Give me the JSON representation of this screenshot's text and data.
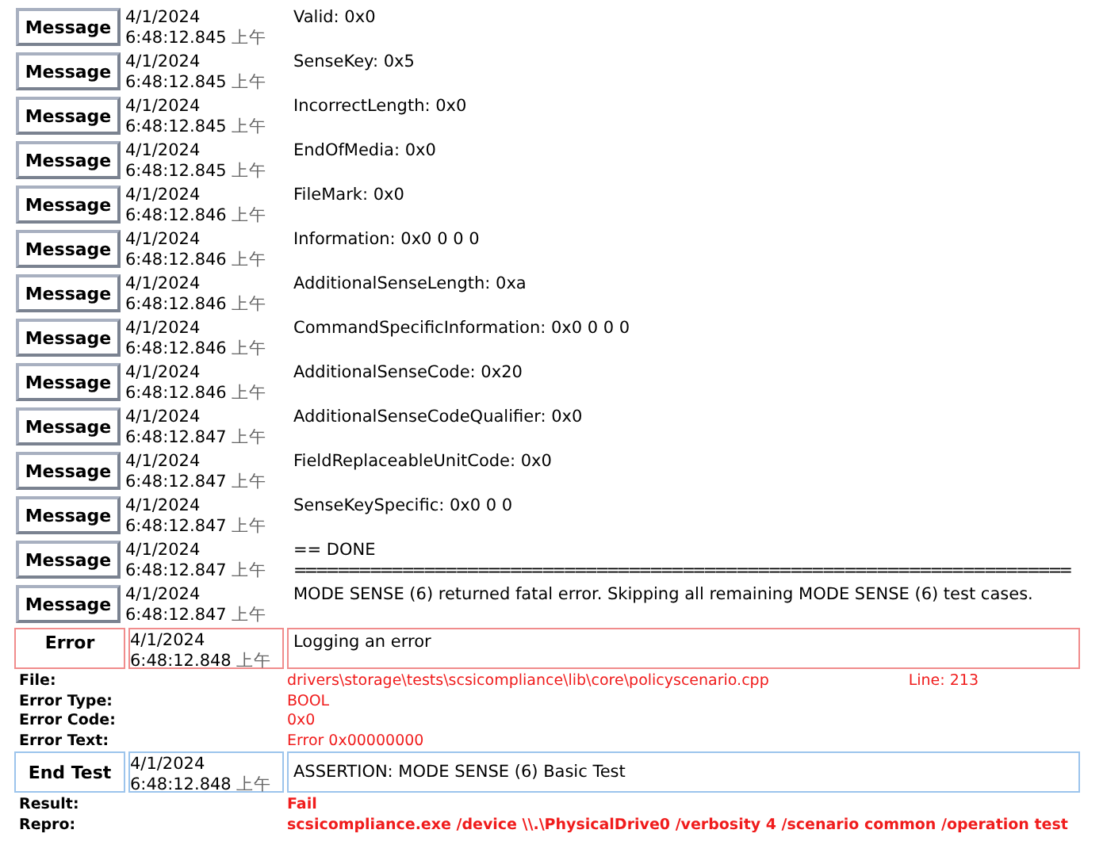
{
  "entries": [
    {
      "kind": "message",
      "label": "Message",
      "date": "4/1/2024",
      "time": "6:48:12.845",
      "ampm": "上午",
      "text": [
        "Valid: 0x0"
      ]
    },
    {
      "kind": "message",
      "label": "Message",
      "date": "4/1/2024",
      "time": "6:48:12.845",
      "ampm": "上午",
      "text": [
        "SenseKey: 0x5"
      ]
    },
    {
      "kind": "message",
      "label": "Message",
      "date": "4/1/2024",
      "time": "6:48:12.845",
      "ampm": "上午",
      "text": [
        "IncorrectLength: 0x0"
      ]
    },
    {
      "kind": "message",
      "label": "Message",
      "date": "4/1/2024",
      "time": "6:48:12.845",
      "ampm": "上午",
      "text": [
        "EndOfMedia: 0x0"
      ]
    },
    {
      "kind": "message",
      "label": "Message",
      "date": "4/1/2024",
      "time": "6:48:12.846",
      "ampm": "上午",
      "text": [
        "FileMark: 0x0"
      ]
    },
    {
      "kind": "message",
      "label": "Message",
      "date": "4/1/2024",
      "time": "6:48:12.846",
      "ampm": "上午",
      "text": [
        "Information: 0x0 0 0 0"
      ]
    },
    {
      "kind": "message",
      "label": "Message",
      "date": "4/1/2024",
      "time": "6:48:12.846",
      "ampm": "上午",
      "text": [
        "AdditionalSenseLength: 0xa"
      ]
    },
    {
      "kind": "message",
      "label": "Message",
      "date": "4/1/2024",
      "time": "6:48:12.846",
      "ampm": "上午",
      "text": [
        "CommandSpecificInformation: 0x0 0 0 0"
      ]
    },
    {
      "kind": "message",
      "label": "Message",
      "date": "4/1/2024",
      "time": "6:48:12.846",
      "ampm": "上午",
      "text": [
        "AdditionalSenseCode: 0x20"
      ]
    },
    {
      "kind": "message",
      "label": "Message",
      "date": "4/1/2024",
      "time": "6:48:12.847",
      "ampm": "上午",
      "text": [
        "AdditionalSenseCodeQualifier: 0x0"
      ]
    },
    {
      "kind": "message",
      "label": "Message",
      "date": "4/1/2024",
      "time": "6:48:12.847",
      "ampm": "上午",
      "text": [
        "FieldReplaceableUnitCode: 0x0"
      ]
    },
    {
      "kind": "message",
      "label": "Message",
      "date": "4/1/2024",
      "time": "6:48:12.847",
      "ampm": "上午",
      "text": [
        "SenseKeySpecific: 0x0 0 0"
      ]
    },
    {
      "kind": "message",
      "label": "Message",
      "date": "4/1/2024",
      "time": "6:48:12.847",
      "ampm": "上午",
      "text": [
        "== DONE",
        "========================================================================"
      ]
    },
    {
      "kind": "message",
      "label": "Message",
      "date": "4/1/2024",
      "time": "6:48:12.847",
      "ampm": "上午",
      "text": [
        "MODE SENSE (6) returned fatal error. Skipping all remaining MODE SENSE (6) test cases."
      ]
    },
    {
      "kind": "error",
      "label": "Error",
      "date": "4/1/2024",
      "time": "6:48:12.848",
      "ampm": "上午",
      "text": [
        "Logging an error"
      ],
      "details": [
        {
          "label": "File:",
          "value": "drivers\\storage\\tests\\scsicompliance\\lib\\core\\policyscenario.cpp",
          "extra": "Line: 213"
        },
        {
          "label": "Error Type:",
          "value": "BOOL"
        },
        {
          "label": "Error Code:",
          "value": "0x0"
        },
        {
          "label": "Error Text:",
          "value": "Error 0x00000000"
        }
      ]
    },
    {
      "kind": "end_test",
      "label": "End Test",
      "date": "4/1/2024",
      "time": "6:48:12.848",
      "ampm": "上午",
      "text": [
        "ASSERTION: MODE SENSE (6) Basic Test"
      ],
      "details": [
        {
          "label": "Result:",
          "value": "Fail"
        },
        {
          "label": "Repro:",
          "value": "scsicompliance.exe /device \\\\.\\PhysicalDrive0 /verbosity 4 /scenario common /operation test"
        }
      ]
    }
  ]
}
